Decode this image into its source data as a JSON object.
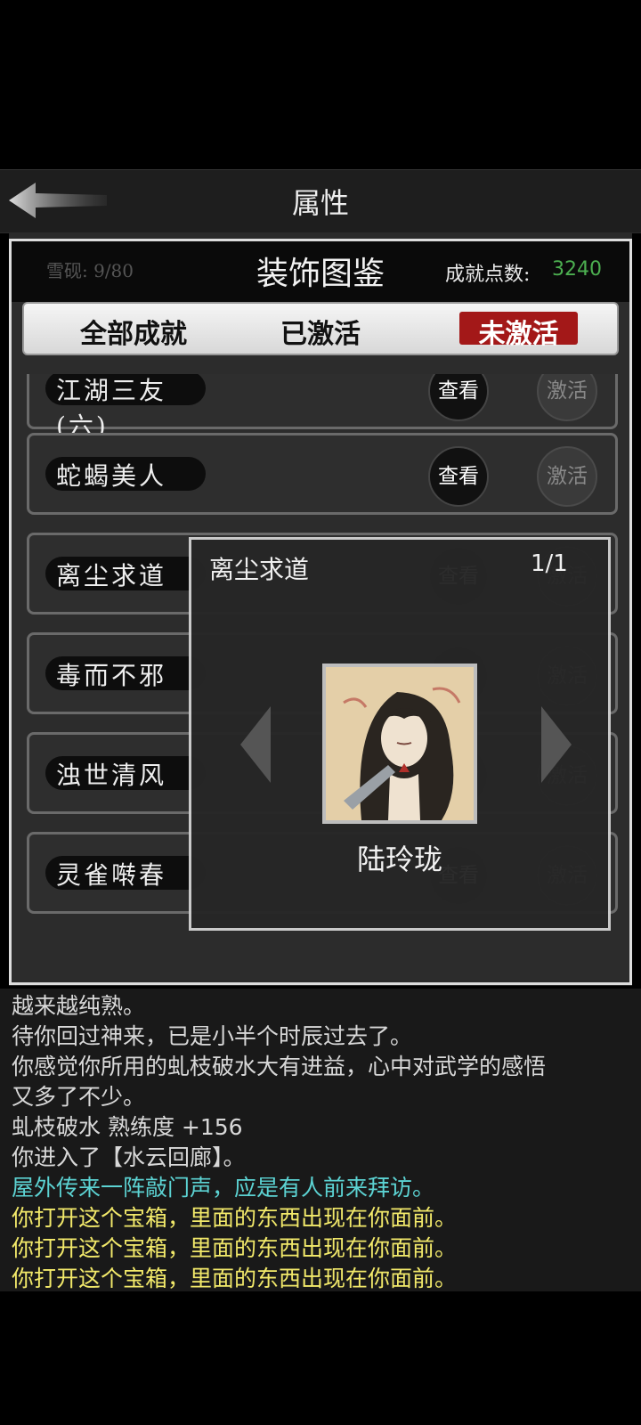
{
  "header": {
    "title": "属性"
  },
  "panel": {
    "title": "装饰图鉴",
    "score_label": "成就点数:",
    "score_value": "3240",
    "ghost_text": "雪砚: 9/80"
  },
  "tabs": [
    {
      "label": "全部成就",
      "selected": false
    },
    {
      "label": "已激活",
      "selected": false
    },
    {
      "label": "未激活",
      "selected": true
    }
  ],
  "list": {
    "view_label": "查看",
    "activate_label": "激活",
    "items": [
      {
        "name": "江湖三友(六)"
      },
      {
        "name": "蛇蝎美人"
      },
      {
        "name": "离尘求道"
      },
      {
        "name": "毒而不邪"
      },
      {
        "name": "浊世清风"
      },
      {
        "name": "灵雀啭春"
      }
    ]
  },
  "popup": {
    "title": "离尘求道",
    "count": "1/1",
    "character_name": "陆玲珑"
  },
  "log": [
    {
      "text": "越来越纯熟。",
      "color": "normal"
    },
    {
      "text": "待你回过神来，已是小半个时辰过去了。",
      "color": "normal"
    },
    {
      "text": "你感觉你所用的虬枝破水大有进益，心中对武学的感悟",
      "color": "normal"
    },
    {
      "text": "又多了不少。",
      "color": "normal"
    },
    {
      "text": "虬枝破水 熟练度 +156",
      "color": "normal"
    },
    {
      "text": "你进入了【水云回廊】。",
      "color": "normal"
    },
    {
      "text": "屋外传来一阵敲门声，应是有人前来拜访。",
      "color": "cyan"
    },
    {
      "text": "你打开这个宝箱，里面的东西出现在你面前。",
      "color": "yellow"
    },
    {
      "text": "你打开这个宝箱，里面的东西出现在你面前。",
      "color": "yellow"
    },
    {
      "text": "你打开这个宝箱，里面的东西出现在你面前。",
      "color": "yellow"
    }
  ],
  "colors": {
    "accent_red": "#a31818",
    "score_green": "#4caf50",
    "log_cyan": "#5cd3d3",
    "log_yellow": "#f2e96a"
  },
  "icons": {
    "back": "back-arrow-icon",
    "prev": "chevron-left-icon",
    "next": "chevron-right-icon"
  }
}
